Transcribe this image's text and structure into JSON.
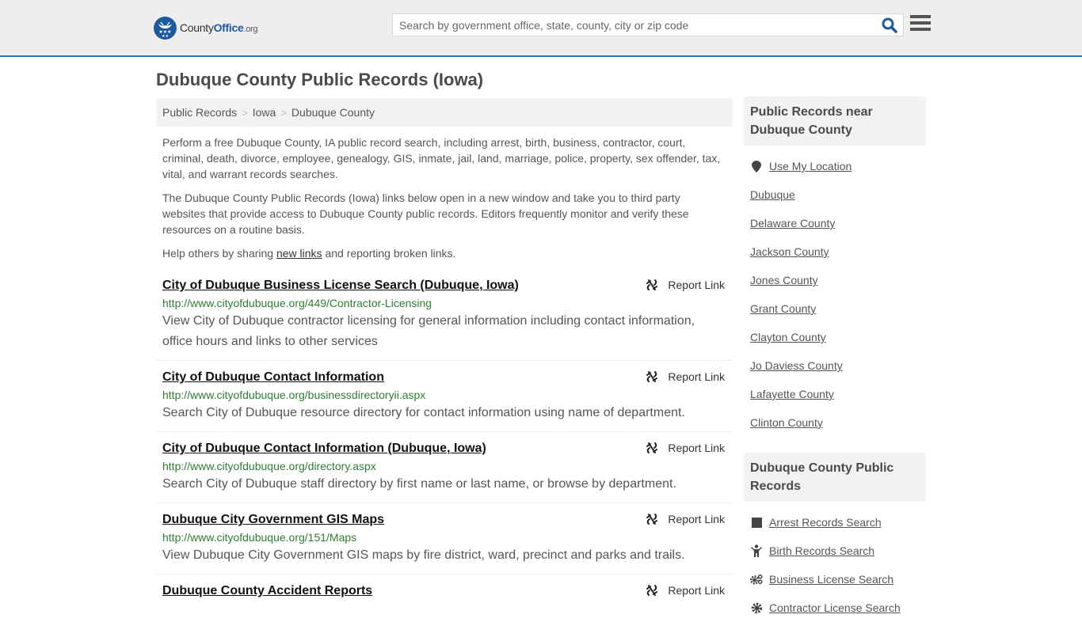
{
  "header": {
    "logo": {
      "name_part1": "County",
      "name_part2": "Office",
      "tld": ".org"
    },
    "search": {
      "placeholder": "Search by government office, state, county, city or zip code",
      "value": ""
    },
    "accent_color": "#2e75b6"
  },
  "page_title": "Dubuque County Public Records (Iowa)",
  "breadcrumb": [
    {
      "label": "Public Records"
    },
    {
      "label": "Iowa"
    },
    {
      "label": "Dubuque County"
    }
  ],
  "breadcrumb_separator": ">",
  "intro": {
    "p1": "Perform a free Dubuque County, IA public record search, including arrest, birth, business, contractor, court, criminal, death, divorce, employee, genealogy, GIS, inmate, jail, land, marriage, police, property, sex offender, tax, vital, and warrant records searches.",
    "p2": "The Dubuque County Public Records (Iowa) links below open in a new window and take you to third party websites that provide access to Dubuque County public records. Editors frequently monitor and verify these resources on a routine basis.",
    "p3_before": "Help others by sharing ",
    "p3_link": "new links",
    "p3_after": " and reporting broken links."
  },
  "report_label": "Report Link",
  "records": [
    {
      "title": "City of Dubuque Business License Search (Dubuque, Iowa)",
      "url": "http://www.cityofdubuque.org/449/Contractor-Licensing",
      "description": "View City of Dubuque contractor licensing for general information including contact information, office hours and links to other services"
    },
    {
      "title": "City of Dubuque Contact Information",
      "url": "http://www.cityofdubuque.org/businessdirectoryii.aspx",
      "description": "Search City of Dubuque resource directory for contact information using name of department."
    },
    {
      "title": "City of Dubuque Contact Information (Dubuque, Iowa)",
      "url": "http://www.cityofdubuque.org/directory.aspx",
      "description": "Search City of Dubuque staff directory by first name or last name, or browse by department."
    },
    {
      "title": "Dubuque City Government GIS Maps",
      "url": "http://www.cityofdubuque.org/151/Maps",
      "description": "View Dubuque City Government GIS maps by fire district, ward, precinct and parks and trails."
    },
    {
      "title": "Dubuque County Accident Reports",
      "url": "",
      "description": ""
    }
  ],
  "sidebar": {
    "nearby": {
      "heading": "Public Records near Dubuque County",
      "use_location": {
        "label": "Use My Location",
        "icon": "map-marker-icon"
      },
      "items": [
        "Dubuque",
        "Delaware County",
        "Jackson County",
        "Jones County",
        "Grant County",
        "Clayton County",
        "Jo Daviess County",
        "Lafayette County",
        "Clinton County"
      ]
    },
    "categories": {
      "heading": "Dubuque County Public Records",
      "items": [
        {
          "label": "Arrest Records Search",
          "icon": "square-icon"
        },
        {
          "label": "Birth Records Search",
          "icon": "child-icon"
        },
        {
          "label": "Business License Search",
          "icon": "gears-icon"
        },
        {
          "label": "Contractor License Search",
          "icon": "gear-icon"
        }
      ]
    }
  }
}
